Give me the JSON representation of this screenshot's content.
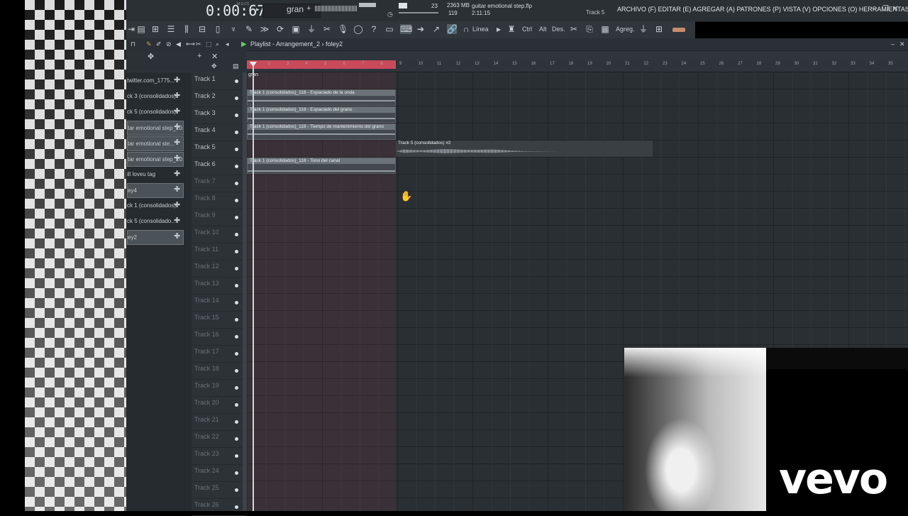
{
  "topbar": {
    "time": "0:00:67",
    "time_sub": "M:S:CS",
    "pattern_name": "gran",
    "memory": "2363 MB",
    "cpu": "119",
    "cpu_top": "23",
    "project_name": "guitar emotional step.flp",
    "project_time": "2:11:15",
    "hint_track": "Track 5",
    "menu": "ARCHIVO (F) EDITAR (E) AGREGAR (A) PATRONES (P) VISTA (V) OPCIONES (O) HERRAMIENTAS (T) AYUDA"
  },
  "toolbar": {
    "line_label": "Línea",
    "ctrl_label": "Ctrl",
    "alt_label": "Alt",
    "des_label": "Des.",
    "agreg_label": "Agreg."
  },
  "playlist": {
    "title": "Playlist - Arrangement_2 › foley2",
    "browser_items": [
      {
        "label": "twitter.com_1775...",
        "selected": false
      },
      {
        "label": "ck 3 (consolidados)",
        "selected": false
      },
      {
        "label": "ck 5 (consolidados)",
        "selected": false
      },
      {
        "label": "tar emotional step_20...",
        "selected": true
      },
      {
        "label": "tar emotional ste...",
        "selected": true
      },
      {
        "label": "tar emotional step_20...",
        "selected": true
      },
      {
        "label": "ill loveu tag",
        "selected": false
      },
      {
        "label": "ey4",
        "selected": true
      },
      {
        "label": "ck 1 (consolidados)",
        "selected": false
      },
      {
        "label": "ck 5 (consolidado...",
        "selected": false
      },
      {
        "label": "ey2",
        "selected": true
      }
    ],
    "tracks": [
      "Track 1",
      "Track 2",
      "Track 3",
      "Track 4",
      "Track 5",
      "Track 6",
      "Track 7",
      "Track 8",
      "Track 9",
      "Track 10",
      "Track 11",
      "Track 12",
      "Track 13",
      "Track 14",
      "Track 15",
      "Track 16",
      "Track 17",
      "Track 18",
      "Track 19",
      "Track 20",
      "Track 21",
      "Track 22",
      "Track 23",
      "Track 24",
      "Track 25",
      "Track 26"
    ],
    "bar_numbers": [
      "1",
      "2",
      "3",
      "4",
      "5",
      "6",
      "7",
      "8",
      "9",
      "10",
      "11",
      "12",
      "13",
      "14",
      "15",
      "16",
      "17",
      "18",
      "19",
      "20",
      "21",
      "22",
      "23",
      "24",
      "25",
      "26",
      "27",
      "28",
      "29",
      "30",
      "31",
      "32",
      "33",
      "34",
      "35"
    ],
    "clips": {
      "gran": "gran",
      "espaciado_onda": "Track 1 (consolidados)_118 - Espaciado de la onda",
      "espaciado_grano": "Track 1 (consolidados)_118 - Espaciado del grano",
      "tiempo_grano": "Track 1 (consolidados)_118 - Tiempo de mantenimiento del grano",
      "audio_track5": "Track 5 (consolidados) #2",
      "tono_canal": "Track 1 (consolidados)_118 - Tono del canal"
    }
  },
  "overlay": {
    "logo": "vevo"
  }
}
